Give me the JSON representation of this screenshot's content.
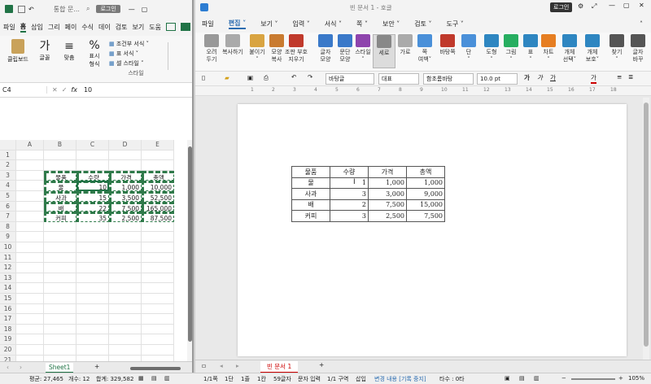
{
  "excel": {
    "title": "통합 문...",
    "login_label": "로그인",
    "menu": [
      "파일",
      "홈",
      "삽입",
      "그리",
      "페이",
      "수식",
      "데이",
      "검토",
      "보기",
      "도움"
    ],
    "active_menu": "홈",
    "ribbon": {
      "clipboard": "클립보드",
      "font": "글꼴",
      "align": "맞춤",
      "number_1": "표시",
      "number_2": "형식",
      "cond_format": "조건부 서식 ˅",
      "table_format": "표 서식 ˅",
      "cell_style": "셀 스타일 ˅",
      "style_group": "스타일"
    },
    "name_box": "C4",
    "formula_value": "10",
    "fx": "fx",
    "columns": [
      "A",
      "B",
      "C",
      "D",
      "E"
    ],
    "rows": [
      "1",
      "2",
      "3",
      "4",
      "5",
      "6",
      "7",
      "8",
      "9",
      "10",
      "11",
      "12",
      "13",
      "14",
      "15",
      "16",
      "17",
      "18",
      "19",
      "20",
      "21"
    ],
    "table": {
      "headers": [
        "물품",
        "수량",
        "가격",
        "총액"
      ],
      "rows": [
        [
          "물",
          "10",
          "1,000",
          "10,000"
        ],
        [
          "사과",
          "15",
          "3,500",
          "52,500"
        ],
        [
          "배",
          "22",
          "7,500",
          "165,000"
        ],
        [
          "커피",
          "35",
          "2,500",
          "87,500"
        ]
      ]
    },
    "sheet_tab": "Sheet1",
    "status": {
      "avg": "평균: 27,465",
      "count": "개수: 12",
      "sum": "합계: 329,582"
    }
  },
  "hwp": {
    "title": "빈 문서 1 - 호글",
    "login_label": "로그인",
    "menu": [
      "파일",
      "편집 ˅",
      "보기 ˅",
      "입력 ˅",
      "서식 ˅",
      "쪽 ˅",
      "보안 ˅",
      "검토 ˅",
      "도구 ˅"
    ],
    "ribbon": [
      "오려\n두기",
      "복사하기",
      "붙이기\n˅",
      "모양\n복사",
      "조판 부호\n지우기",
      "글자\n모양",
      "문단\n모양",
      "스타일\n˅",
      "세로",
      "가로",
      "쪽\n여백˅",
      "바탕쪽",
      "단\n˅",
      "도형\n˅",
      "그림\n˅",
      "표\n˅",
      "차트\n˅",
      "개체\n선택˅",
      "개체\n보호˅",
      "찾기\n˅",
      "글자\n바꾸"
    ],
    "toolbar": {
      "style": "바탕글",
      "lang": "대표",
      "font": "함초롬바탕",
      "size": "10.0",
      "unit": "pt"
    },
    "ruler_marks": [
      "1",
      "2",
      "3",
      "4",
      "5",
      "6",
      "7",
      "8",
      "9",
      "10",
      "11",
      "12",
      "13",
      "14",
      "15",
      "16",
      "17",
      "18"
    ],
    "table": {
      "headers": [
        "물품",
        "수량",
        "가격",
        "총액"
      ],
      "rows": [
        [
          "물",
          "1",
          "1,000",
          "1,000"
        ],
        [
          "사과",
          "3",
          "3,000",
          "9,000"
        ],
        [
          "배",
          "2",
          "7,500",
          "15,000"
        ],
        [
          "커피",
          "3",
          "2,500",
          "7,500"
        ]
      ]
    },
    "doc_tab": "빈 문서 1",
    "status": {
      "page": "1/1쪽",
      "section": "1단",
      "line": "1줄",
      "col": "1칸",
      "chars": "59글자",
      "mode": "문자 입력",
      "area": "1/1 구역",
      "insert": "삽입",
      "track": "변경 내용 [기록 중지]",
      "tasks": "타수 : 0타",
      "zoom": "105%"
    }
  }
}
